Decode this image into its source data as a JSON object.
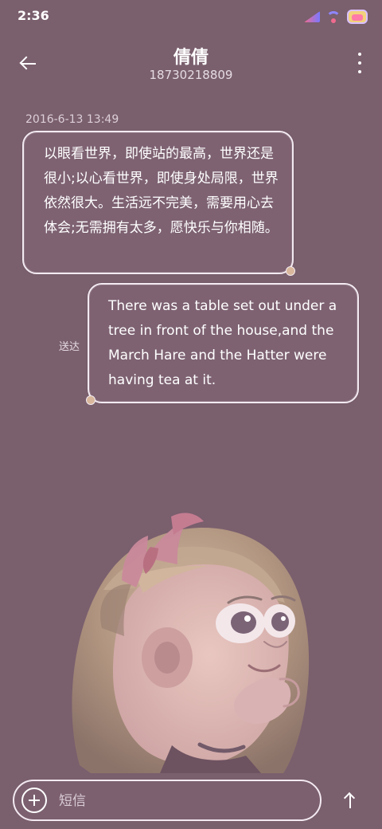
{
  "status_bar": {
    "time": "2:36",
    "icons": [
      "signal-icon",
      "wifi-icon",
      "battery-icon"
    ]
  },
  "header": {
    "contact_name": "倩倩",
    "contact_number": "18730218809",
    "back_icon": "back-arrow-icon",
    "more_icon": "more-vertical-icon"
  },
  "conversation": {
    "timestamp": "2016-6-13 13:49",
    "messages": [
      {
        "direction": "incoming",
        "text": "以眼看世界，即使站的最高，世界还是很小;以心看世界，即使身处局限，世界依然很大。生活远不完美，需要用心去体会;无需拥有太多，愿快乐与你相随。"
      },
      {
        "direction": "outgoing",
        "text": "There was a table set out under a tree in front of the house,and the March Hare and the Hatter were having tea at it.",
        "status": "送达"
      }
    ]
  },
  "composer": {
    "placeholder": "短信",
    "add_icon": "plus-icon",
    "send_icon": "send-arrow-icon"
  },
  "colors": {
    "background": "#7a5f6d",
    "bubble_border": "#f3eaf1",
    "text": "#ffffff",
    "secondary_text": "#dccfd8"
  }
}
